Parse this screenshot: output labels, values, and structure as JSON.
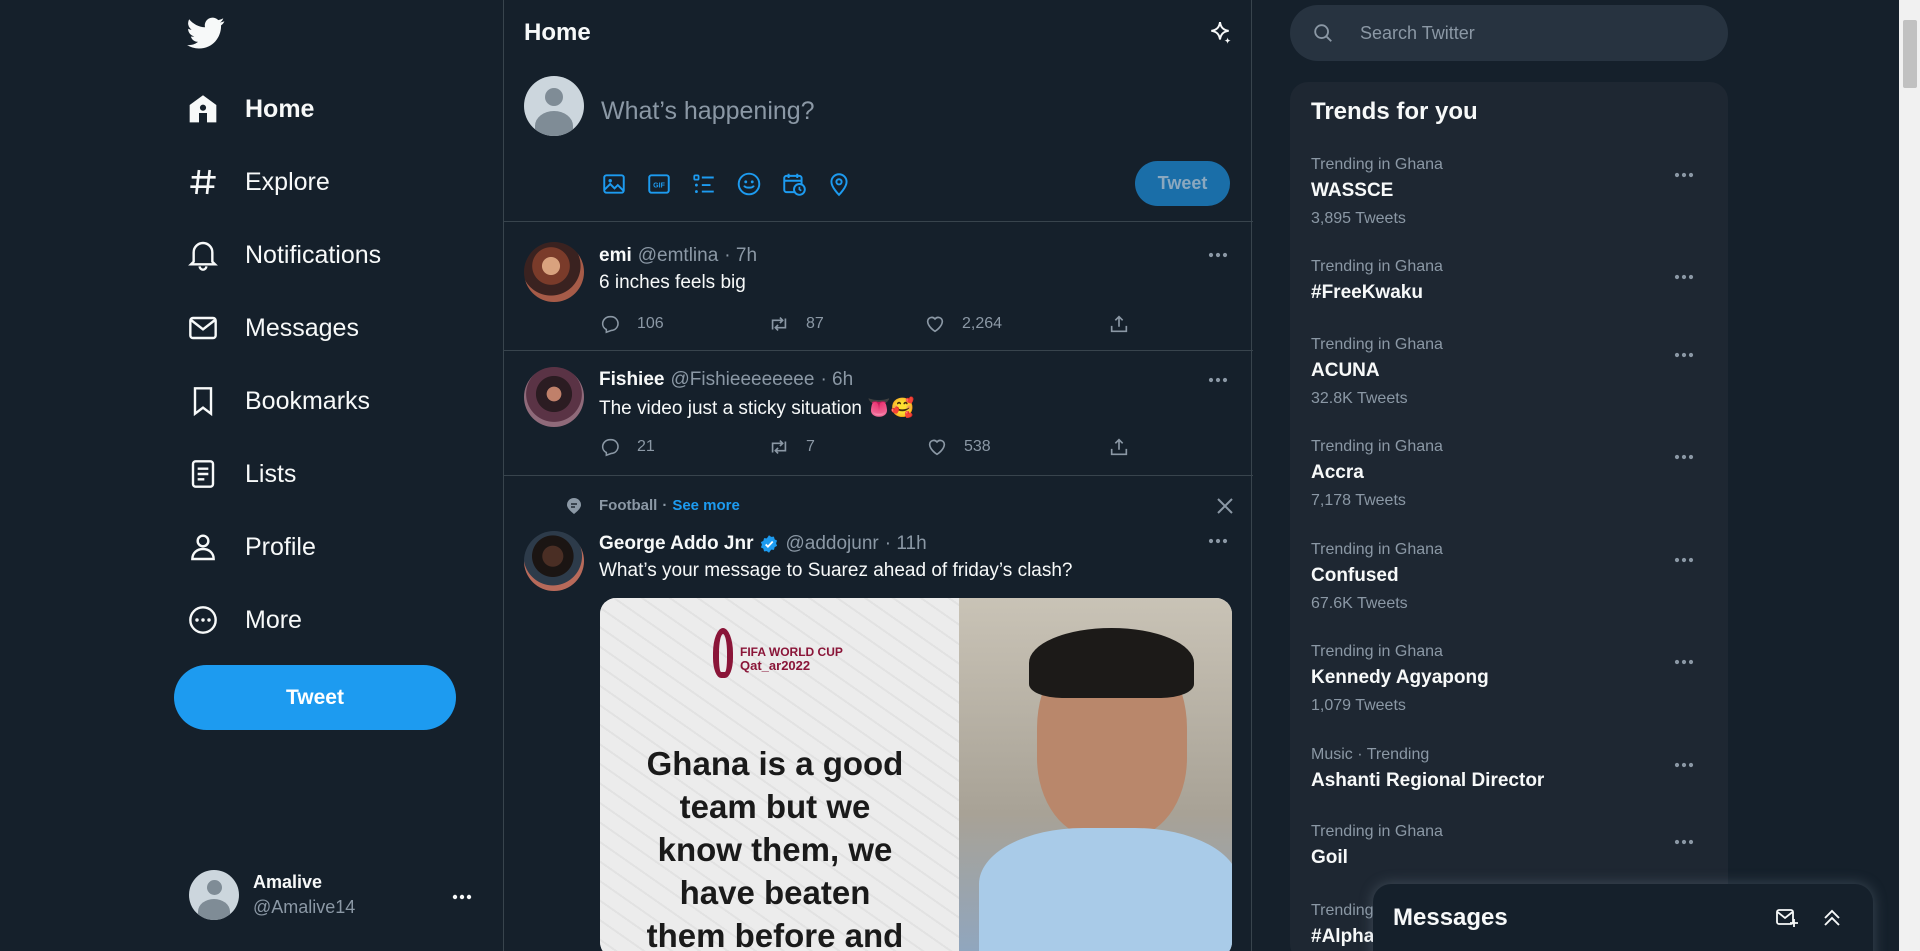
{
  "nav": {
    "items": [
      {
        "label": "Home",
        "icon": "home-icon"
      },
      {
        "label": "Explore",
        "icon": "hashtag-icon"
      },
      {
        "label": "Notifications",
        "icon": "bell-icon"
      },
      {
        "label": "Messages",
        "icon": "envelope-icon"
      },
      {
        "label": "Bookmarks",
        "icon": "bookmark-icon"
      },
      {
        "label": "Lists",
        "icon": "list-icon"
      },
      {
        "label": "Profile",
        "icon": "person-icon"
      },
      {
        "label": "More",
        "icon": "more-circle-icon"
      }
    ],
    "tweet_button": "Tweet"
  },
  "account": {
    "name": "Amalive",
    "handle": "@Amalive14"
  },
  "header": {
    "title": "Home"
  },
  "composer": {
    "placeholder": "What’s happening?",
    "button": "Tweet"
  },
  "tweets": [
    {
      "name": "emi",
      "handle": "@emtlina",
      "time": "· 7h",
      "text": "6 inches feels big",
      "replies": "106",
      "retweets": "87",
      "likes": "2,264"
    },
    {
      "name": "Fishiee",
      "handle": "@Fishieeeeeeee",
      "time": "· 6h",
      "text": "The video just a sticky situation 👅🥰",
      "replies": "21",
      "retweets": "7",
      "likes": "538"
    }
  ],
  "topic_tweet": {
    "topic": "Football",
    "topic_sep": "·",
    "see_more": "See more",
    "name": "George Addo Jnr",
    "handle": "@addojunr",
    "time": "· 11h",
    "text": "What’s your message to Suarez ahead of friday’s clash?",
    "image_logo_top": "FIFA WORLD CUP",
    "image_logo_bottom": "Qat_ar2022",
    "image_quote_lines": [
      "Ghana is a good",
      "team but we",
      "know them, we",
      "have beaten",
      "them before and"
    ]
  },
  "search": {
    "placeholder": "Search Twitter"
  },
  "trends": {
    "title": "Trends for you",
    "items": [
      {
        "context": "Trending in Ghana",
        "title": "WASSCE",
        "count": "3,895 Tweets"
      },
      {
        "context": "Trending in Ghana",
        "title": "#FreeKwaku",
        "count": ""
      },
      {
        "context": "Trending in Ghana",
        "title": "ACUNA",
        "count": "32.8K Tweets"
      },
      {
        "context": "Trending in Ghana",
        "title": "Accra",
        "count": "7,178 Tweets"
      },
      {
        "context": "Trending in Ghana",
        "title": "Confused",
        "count": "67.6K Tweets"
      },
      {
        "context": "Trending in Ghana",
        "title": "Kennedy Agyapong",
        "count": "1,079 Tweets"
      },
      {
        "context": "Music · Trending",
        "title": "Ashanti Regional Director",
        "count": ""
      },
      {
        "context": "Trending in Ghana",
        "title": "Goil",
        "count": ""
      },
      {
        "context": "Trending",
        "title": "#Alpha",
        "count": ""
      }
    ]
  },
  "messages_dock": {
    "title": "Messages"
  },
  "colors": {
    "background": "#15202b",
    "accent": "#1d9bf0",
    "text": "#f7f9f9",
    "muted": "#8b98a5",
    "border": "#38444d"
  }
}
